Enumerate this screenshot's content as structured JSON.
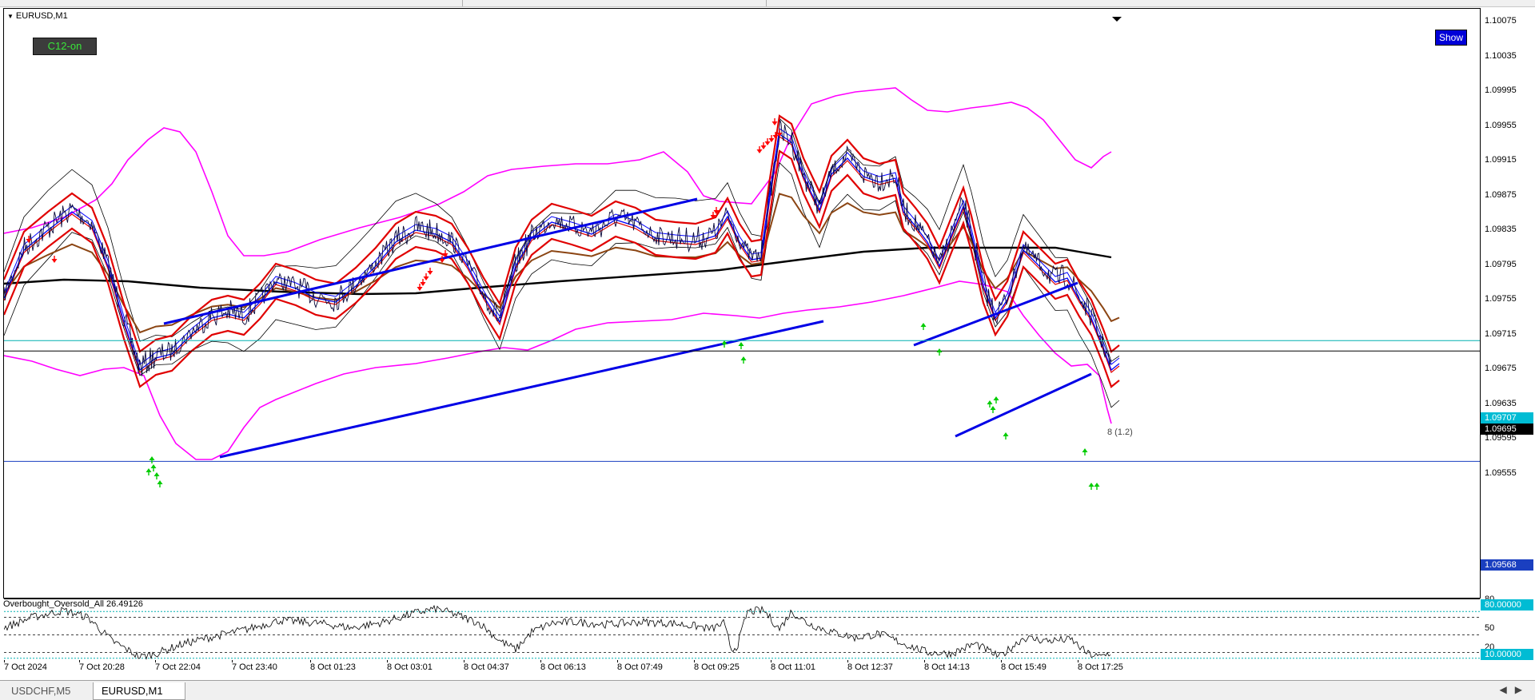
{
  "window": {
    "symbol_label": "EURUSD,M1",
    "c12_button": "C12-on",
    "show_button": "Show",
    "oscillator_label": "Overbought_Oversold_All 26.49126",
    "fib_label": "8 (1.2)"
  },
  "colors": {
    "price": "#0a0a3c",
    "bollinger_outer": "#ff00ff",
    "bollinger_inner": "#000000",
    "envelope": "#e00000",
    "ma_blue": "#0000ff",
    "ma_brown": "#8b4513",
    "ma_long": "#000000",
    "channel": "#0000e6",
    "arrow_up": "#00cc00",
    "arrow_down": "#ff0000",
    "ask_line": "#00b0b0",
    "price_box_bg": "#000000",
    "ask_box_bg": "#00bcd4",
    "level_box_bg": "#1a3fc0"
  },
  "price_axis": {
    "ticks": [
      "1.10075",
      "1.10035",
      "1.09995",
      "1.09955",
      "1.09915",
      "1.09875",
      "1.09835",
      "1.09795",
      "1.09755",
      "1.09715",
      "1.09675",
      "1.09635",
      "1.09595",
      "1.09555"
    ],
    "current_price": "1.09695",
    "ask_price": "1.09707",
    "level_price": "1.09568"
  },
  "osc_axis": {
    "upper_value": "80.00000",
    "mid_value": "50",
    "low_value": "20",
    "lower_value": "10.00000",
    "top_tick": "80"
  },
  "time_axis": {
    "ticks": [
      "7 Oct 2024",
      "7 Oct 20:28",
      "7 Oct 22:04",
      "7 Oct 23:40",
      "8 Oct 01:23",
      "8 Oct 03:01",
      "8 Oct 04:37",
      "8 Oct 06:13",
      "8 Oct 07:49",
      "8 Oct 09:25",
      "8 Oct 11:01",
      "8 Oct 12:37",
      "8 Oct 14:13",
      "8 Oct 15:49",
      "8 Oct 17:25"
    ]
  },
  "tabs": [
    {
      "label": "USDCHF,M5",
      "active": false
    },
    {
      "label": "EURUSD,M1",
      "active": true
    }
  ]
}
